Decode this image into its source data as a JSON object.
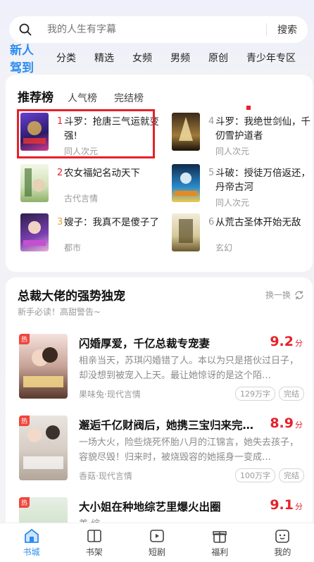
{
  "search": {
    "placeholder": "我的人生有字幕",
    "button": "搜索"
  },
  "tabs": {
    "active": "新人驾到",
    "items": [
      "分类",
      "精选",
      "女频",
      "男频",
      "原创",
      "青少年专区"
    ]
  },
  "ranking": {
    "tabs": [
      "推荐榜",
      "人气榜",
      "完结榜"
    ],
    "items": [
      {
        "num": "1",
        "title": "斗罗：抢唐三气运就变强!",
        "tag": "同人次元"
      },
      {
        "num": "2",
        "title": "农女福妃名动天下",
        "tag": "古代言情"
      },
      {
        "num": "3",
        "title": "嫂子：我真不是傻子了",
        "tag": "都市"
      },
      {
        "num": "4",
        "title": "斗罗：我绝世剑仙，千仞雪护道者",
        "tag": "同人次元"
      },
      {
        "num": "5",
        "title": "斗破：授徒万倍返还，丹帝古河",
        "tag": "同人次元"
      },
      {
        "num": "6",
        "title": "从荒古圣体开始无敌",
        "tag": "玄幻"
      }
    ]
  },
  "recommend": {
    "title": "总裁大佬的强势独宠",
    "subtitle": "新手必读！高甜警告~",
    "refresh": "换一换",
    "hot_label": "热",
    "books": [
      {
        "title": "闪婚厚爱，千亿总裁专宠妻",
        "score": "9.2",
        "unit": "分",
        "desc": "相亲当天，苏琪闪婚错了人。本以为只是搭伙过日子，却没想到被宠入上天。最让她惊讶的是这个陌…",
        "meta": "果味兔·现代言情",
        "words": "129万字",
        "status": "完结"
      },
      {
        "title": "邂逅千亿财阀后，她携三宝归来完虐…",
        "score": "8.9",
        "unit": "分",
        "desc": "一场大火，险些烧死怀胎八月的江锦言，她失去孩子，容貌尽毁！归来时，被烧毁容的她摇身一变成…",
        "meta": "香菇·现代言情",
        "words": "100万字",
        "status": "完结"
      },
      {
        "title": "大小姐在种地综艺里爆火出圈",
        "score": "9.1",
        "unit": "分",
        "desc": "姜 综 ...",
        "meta": "",
        "words": "",
        "status": ""
      }
    ]
  },
  "nav": [
    "书城",
    "书架",
    "短剧",
    "福利",
    "我的"
  ],
  "colors": {
    "accent": "#2b8cf0",
    "rank_red": "#e62129",
    "rank_orange": "#f0a33b"
  }
}
